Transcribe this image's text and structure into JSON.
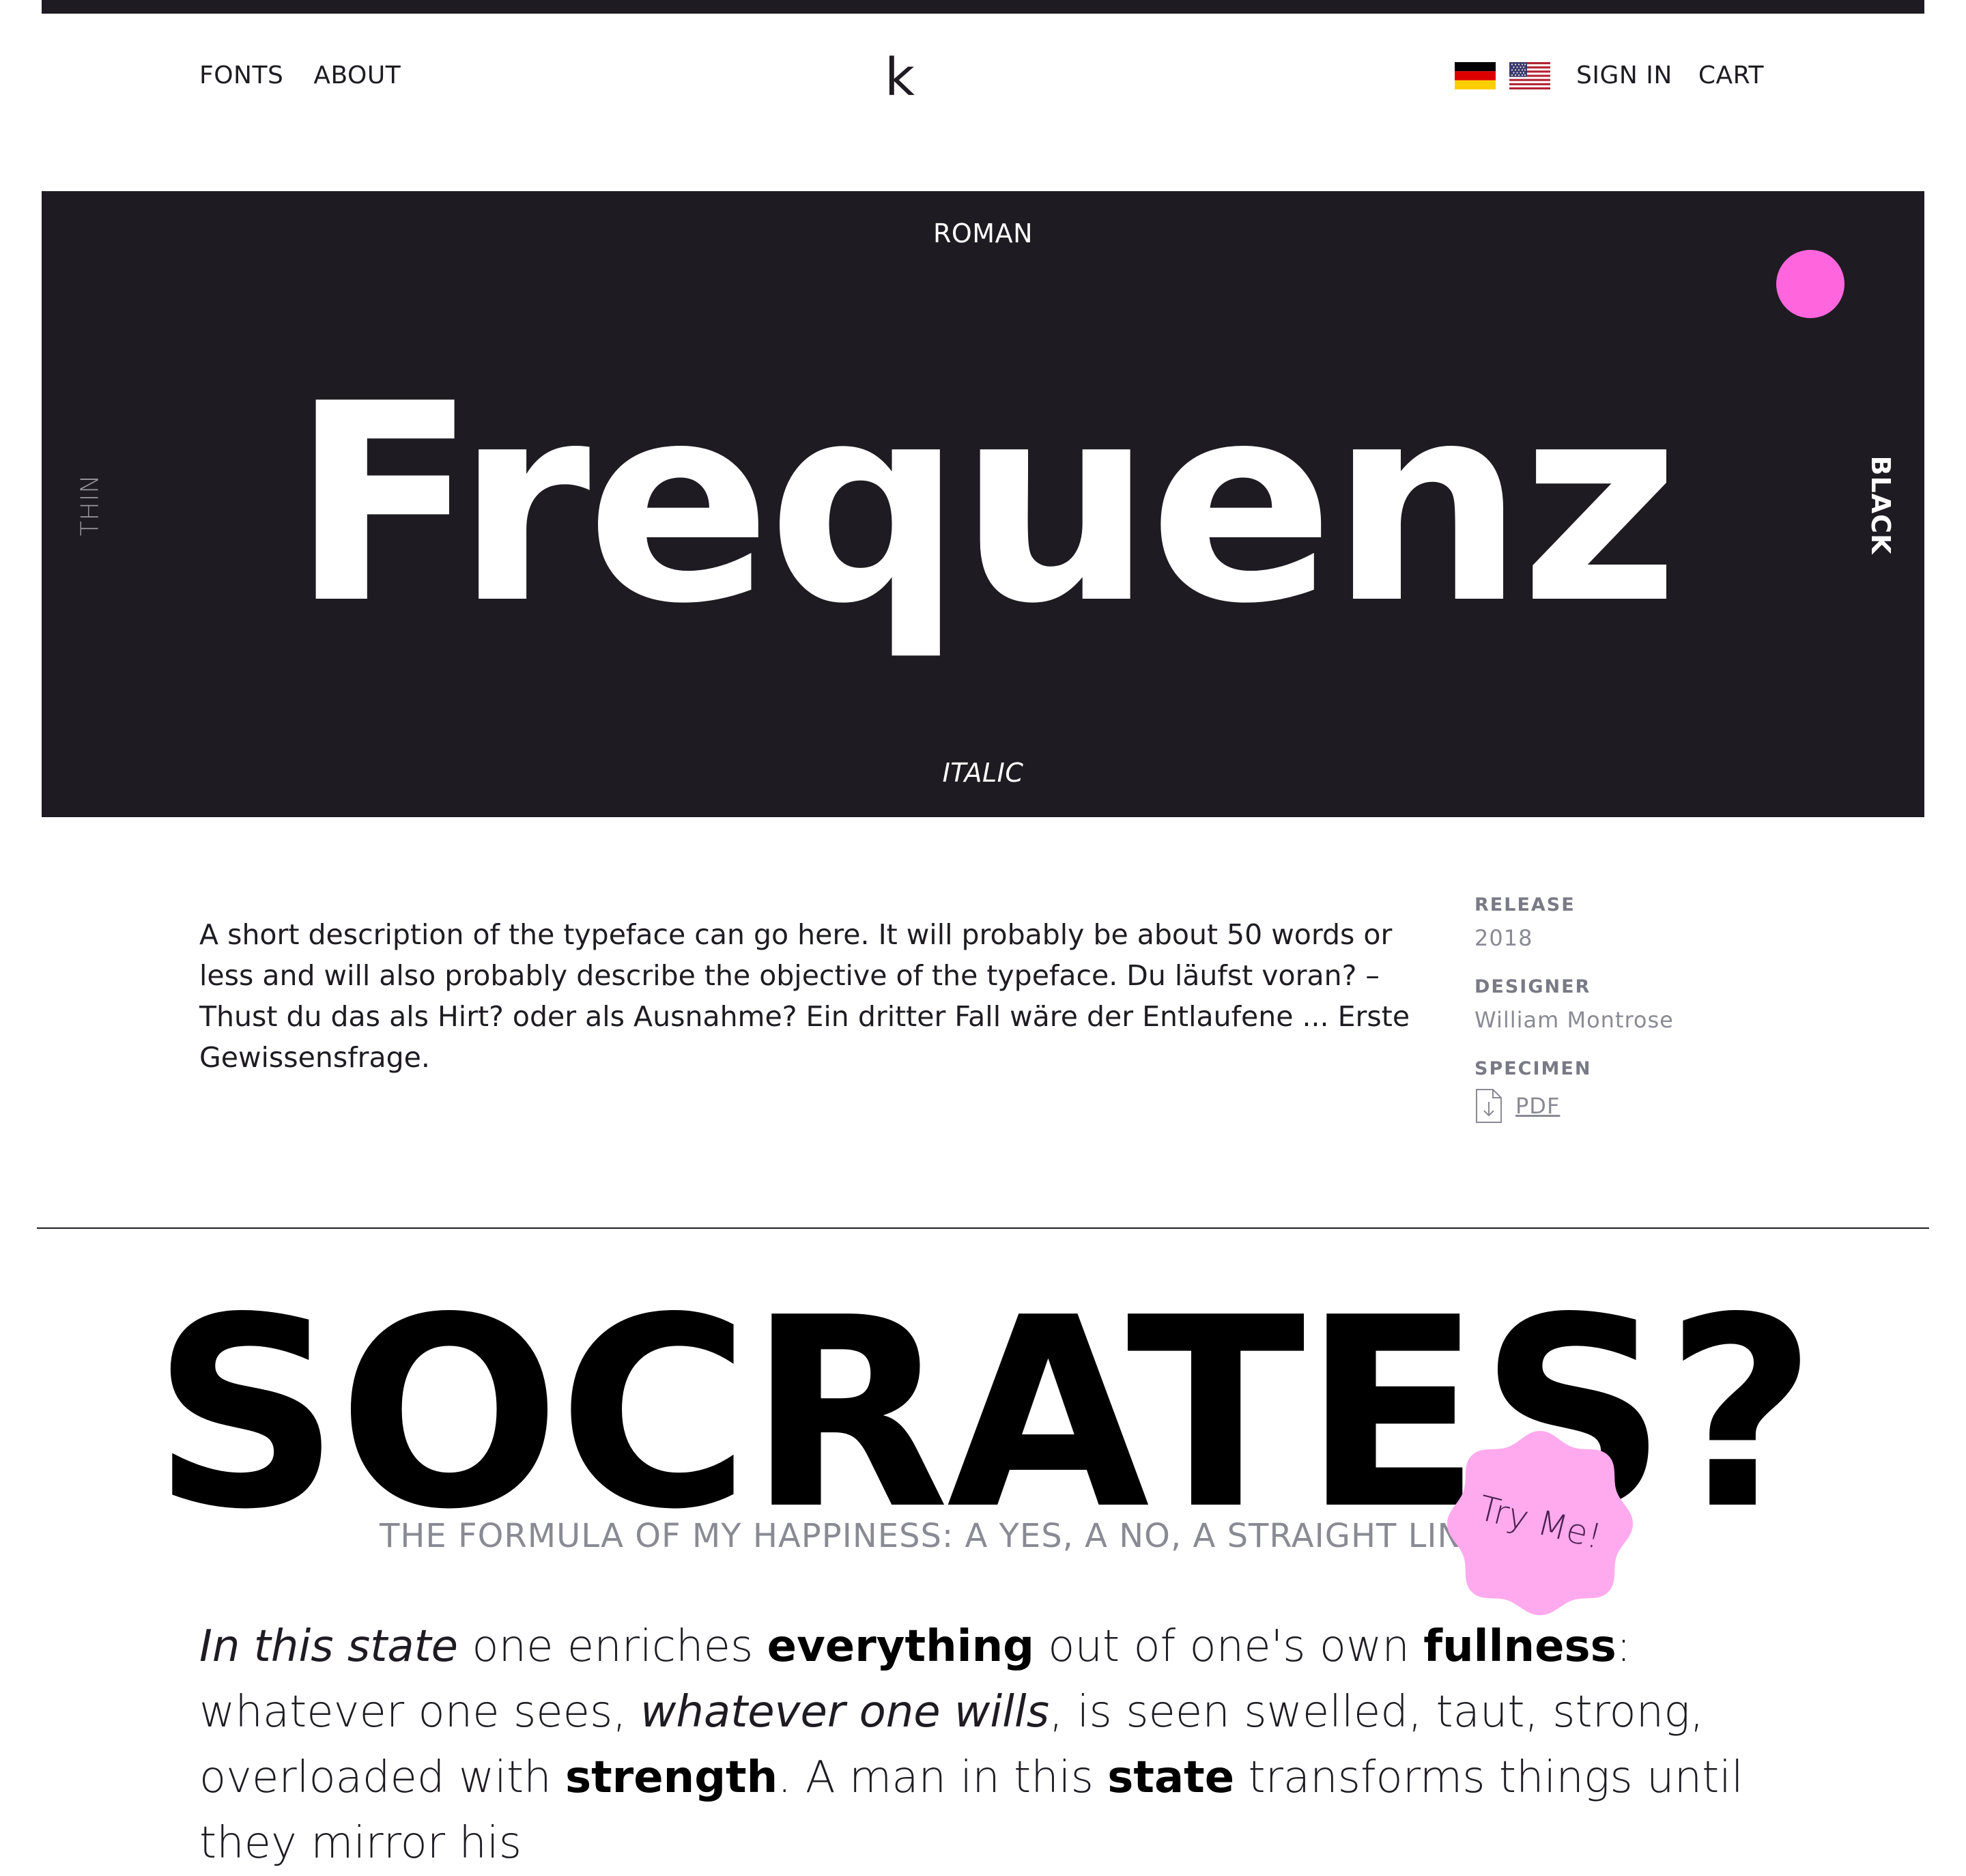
{
  "header": {
    "nav_left": [
      "FONTS",
      "ABOUT"
    ],
    "logo": "k",
    "nav_right": [
      "SIGN IN",
      "CART"
    ],
    "languages": [
      "german-flag-icon",
      "us-flag-icon"
    ]
  },
  "hero": {
    "title": "Frequenz",
    "top_label": "ROMAN",
    "bottom_label": "ITALIC",
    "left_label": "THIN",
    "right_label": "BLACK",
    "background": "#1e1c22",
    "accent": "#ff66dd"
  },
  "about": {
    "description": "A short description of the typeface can go here. It will probably be about 50 words or less and will also probably describe the objective of the typeface. Du läufst voran? – Thust du das als Hirt? oder als Ausnahme? Ein dritter Fall wäre der Entlaufene ... Erste Gewissensfrage.",
    "release_label": "RELEASE",
    "release_value": "2018",
    "designer_label": "DESIGNER",
    "designer_value": "William Montrose",
    "specimen_label": "SPECIMEN",
    "specimen_link": "PDF"
  },
  "specimen": {
    "heading": "SOCRATES?",
    "subtitle": "THE FORMULA OF MY HAPPINESS: A YES, A NO, A STRAIGHT LINE,",
    "badge": "Try Me!",
    "badge_color": "#ffaaee",
    "body": {
      "s1": "In this state",
      "s2": " one enriches ",
      "s3": "everything",
      "s4": " out of one's own ",
      "s5": "fullness",
      "s6": ": whatever one sees, ",
      "s7": "whatever one wills",
      "s8": ", is seen swelled, taut, strong, overloaded with ",
      "s9": "strength",
      "s10": ". A man in this ",
      "s11": "state",
      "s12": " transforms things until they mirror his"
    }
  }
}
